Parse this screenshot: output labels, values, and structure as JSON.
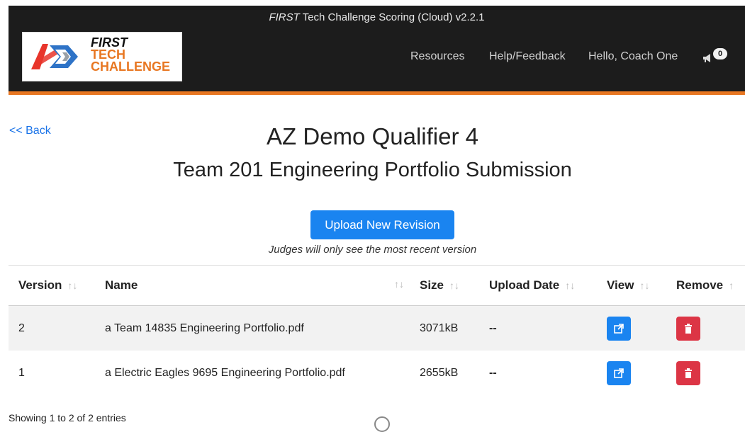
{
  "header": {
    "app_title_prefix": "FIRST",
    "app_title_rest": " Tech Challenge Scoring (Cloud) v2.2.1",
    "logo": {
      "line1": "FIRST",
      "line2": "TECH",
      "line3": "CHALLENGE"
    },
    "nav": {
      "resources": "Resources",
      "help": "Help/Feedback",
      "user": "Hello, Coach One",
      "notification_icon": "megaphone-icon",
      "notification_count": "0"
    },
    "accent_color": "#e87722"
  },
  "page": {
    "back_label": "<< Back",
    "event_title": "AZ Demo Qualifier 4",
    "subtitle": "Team 201 Engineering Portfolio Submission",
    "upload_button": "Upload New Revision",
    "upload_note": "Judges will only see the most recent version"
  },
  "table": {
    "columns": [
      "Version",
      "Name",
      "Size",
      "Upload Date",
      "View",
      "Remove"
    ],
    "rows": [
      {
        "version": "2",
        "name": "a Team 14835 Engineering Portfolio.pdf",
        "size": "3071kB",
        "upload_date": "--"
      },
      {
        "version": "1",
        "name": "a Electric Eagles 9695 Engineering Portfolio.pdf",
        "size": "2655kB",
        "upload_date": "--"
      }
    ]
  },
  "footer": {
    "info": "Showing 1 to 2 of 2 entries"
  },
  "colors": {
    "primary": "#1a84f0",
    "danger": "#dc3545",
    "header_bg": "#1c1c1c"
  }
}
